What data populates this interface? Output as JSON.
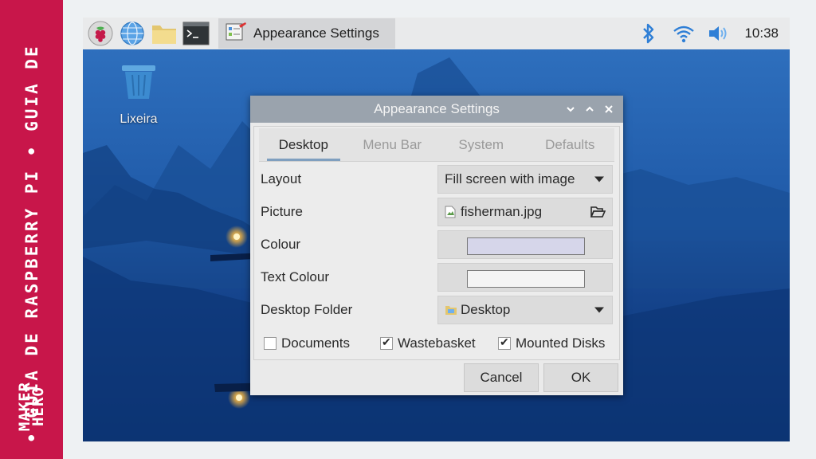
{
  "brand": {
    "vertical_text": "• GUIA DE RASPBERRY PI • GUIA DE",
    "logo_text": "MAKER\nHERO",
    "color": "#c8164a"
  },
  "taskbar": {
    "task_title": "Appearance Settings",
    "clock": "10:38",
    "icons": [
      "raspberry-menu-icon",
      "globe-browser-icon",
      "folder-icon",
      "terminal-icon"
    ],
    "tray_icons": [
      "bluetooth-icon",
      "wifi-icon",
      "volume-icon"
    ]
  },
  "desktop": {
    "trash_label": "Lixeira"
  },
  "dialog": {
    "title": "Appearance Settings",
    "tabs": [
      {
        "label": "Desktop",
        "active": true
      },
      {
        "label": "Menu Bar",
        "active": false
      },
      {
        "label": "System",
        "active": false
      },
      {
        "label": "Defaults",
        "active": false
      }
    ],
    "layout": {
      "label": "Layout",
      "value": "Fill screen with image"
    },
    "picture": {
      "label": "Picture",
      "value": "fisherman.jpg"
    },
    "colour": {
      "label": "Colour",
      "value": "#d6d6ea"
    },
    "text_colour": {
      "label": "Text Colour",
      "value": "#f4f4f4"
    },
    "desktop_folder": {
      "label": "Desktop Folder",
      "value": "Desktop"
    },
    "checks": [
      {
        "label": "Documents",
        "checked": false
      },
      {
        "label": "Wastebasket",
        "checked": true
      },
      {
        "label": "Mounted Disks",
        "checked": true
      }
    ],
    "cancel_label": "Cancel",
    "ok_label": "OK"
  }
}
